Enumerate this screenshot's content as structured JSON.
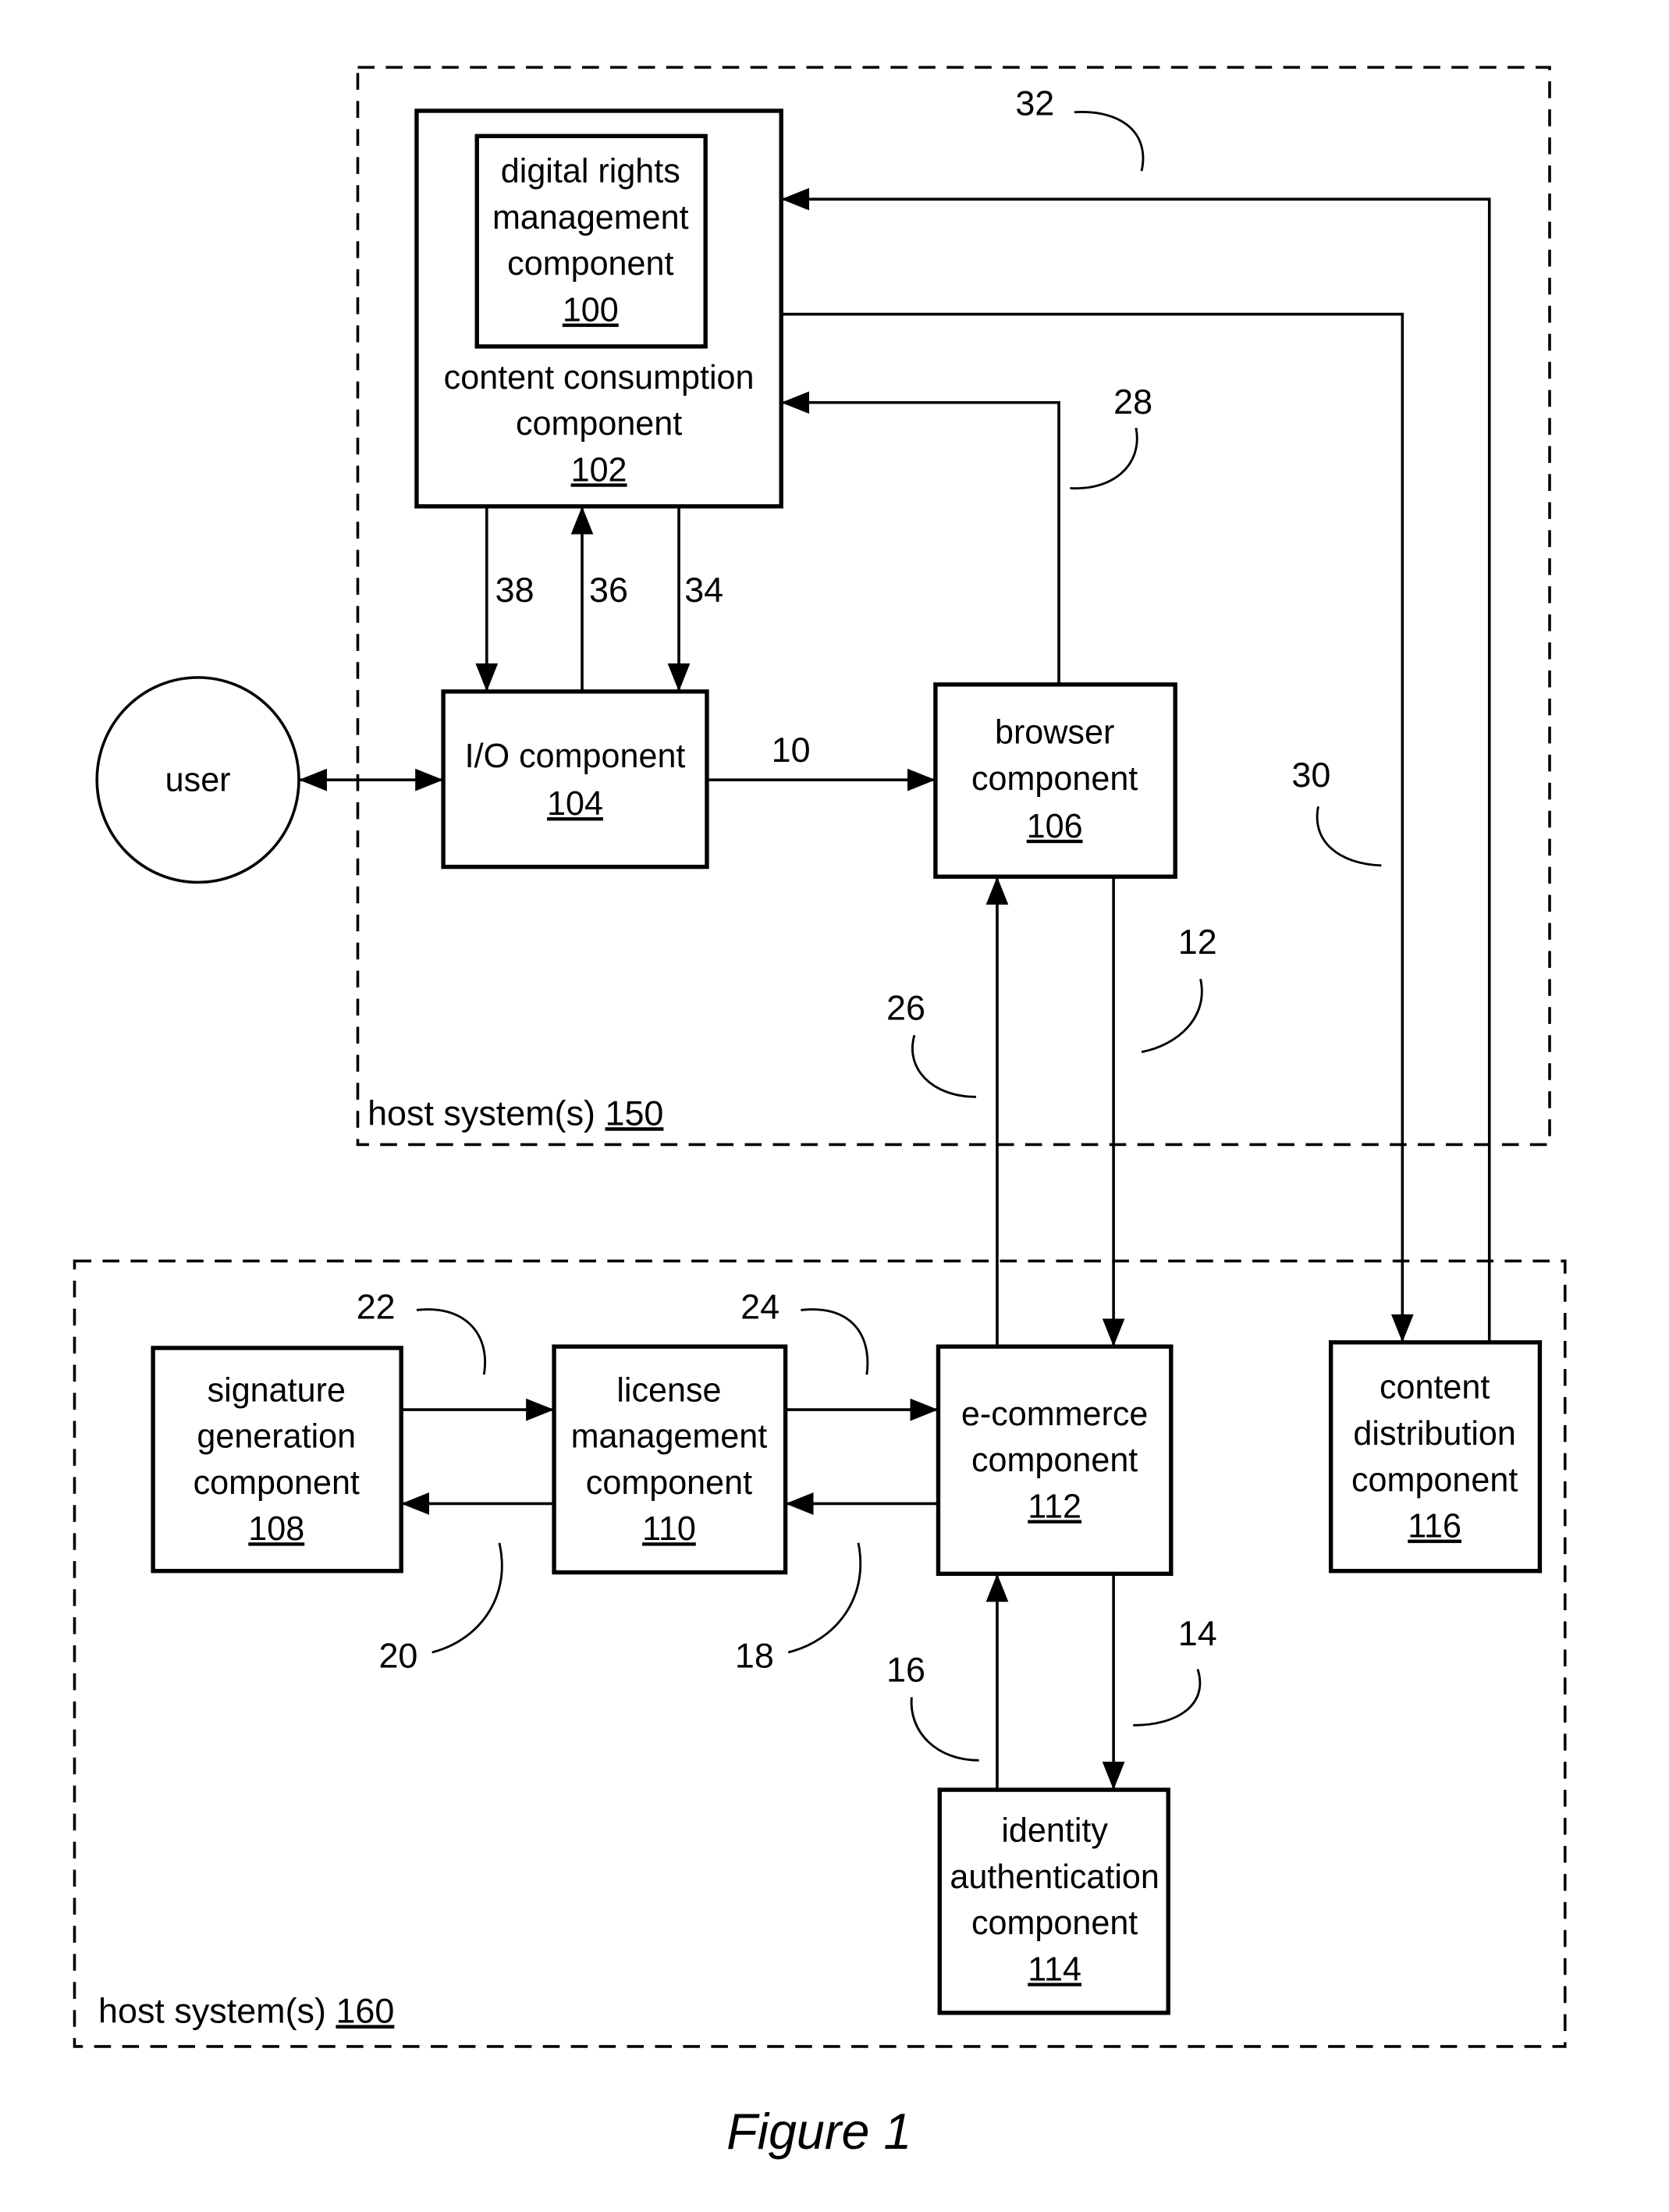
{
  "figure": {
    "caption": "Figure 1",
    "user": {
      "label": "user"
    },
    "host_systems": [
      {
        "label": "host system(s) ",
        "number": "150"
      },
      {
        "label": "host system(s) ",
        "number": "160"
      }
    ],
    "components": {
      "drm": {
        "lines": [
          "digital rights",
          "management",
          "component"
        ],
        "number": "100"
      },
      "content_consumption": {
        "lines": [
          "content consumption",
          "component"
        ],
        "number": "102"
      },
      "io": {
        "lines": [
          "I/O component"
        ],
        "number": "104"
      },
      "browser": {
        "lines": [
          "browser",
          "component"
        ],
        "number": "106"
      },
      "signature_generation": {
        "lines": [
          "signature",
          "generation",
          "component"
        ],
        "number": "108"
      },
      "license_management": {
        "lines": [
          "license",
          "management",
          "component"
        ],
        "number": "110"
      },
      "ecommerce": {
        "lines": [
          "e-commerce",
          "component"
        ],
        "number": "112"
      },
      "identity_authentication": {
        "lines": [
          "identity",
          "authentication",
          "component"
        ],
        "number": "114"
      },
      "content_distribution": {
        "lines": [
          "content",
          "distribution",
          "component"
        ],
        "number": "116"
      }
    },
    "flows": [
      {
        "id": "10",
        "from": "io",
        "to": "browser"
      },
      {
        "id": "12",
        "from": "browser",
        "to": "ecommerce"
      },
      {
        "id": "14",
        "from": "ecommerce",
        "to": "identity_authentication"
      },
      {
        "id": "16",
        "from": "identity_authentication",
        "to": "ecommerce"
      },
      {
        "id": "18",
        "from": "ecommerce",
        "to": "license_management"
      },
      {
        "id": "20",
        "from": "license_management",
        "to": "signature_generation"
      },
      {
        "id": "22",
        "from": "signature_generation",
        "to": "license_management"
      },
      {
        "id": "24",
        "from": "license_management",
        "to": "ecommerce"
      },
      {
        "id": "26",
        "from": "ecommerce",
        "to": "browser"
      },
      {
        "id": "28",
        "from": "browser",
        "to": "content_consumption"
      },
      {
        "id": "30",
        "from": "content_consumption",
        "to": "content_distribution"
      },
      {
        "id": "32",
        "from": "content_distribution",
        "to": "content_consumption"
      },
      {
        "id": "34",
        "from": "content_consumption",
        "to": "io"
      },
      {
        "id": "36",
        "from": "io",
        "to": "content_consumption"
      },
      {
        "id": "38",
        "from": "content_consumption",
        "to": "io"
      }
    ]
  }
}
